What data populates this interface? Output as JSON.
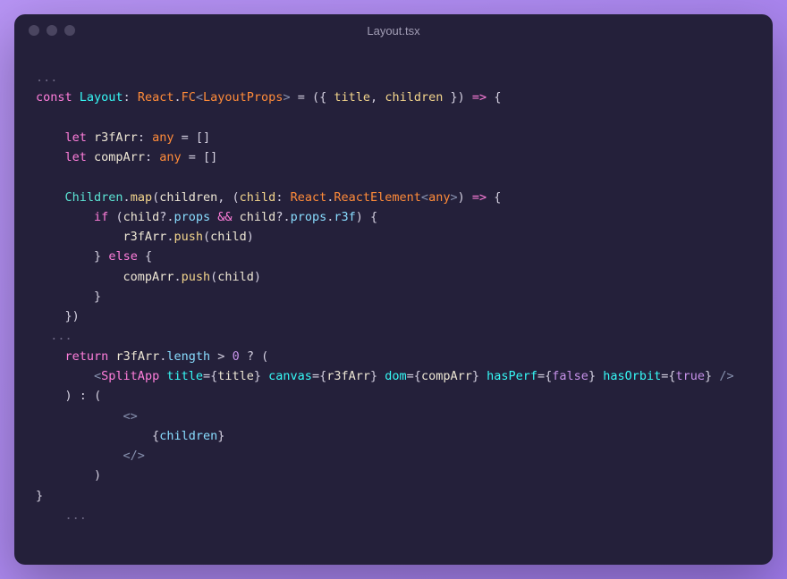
{
  "window": {
    "title": "Layout.tsx"
  },
  "colors": {
    "keyword": "#ff7edb",
    "type": "#ff8b39",
    "const": "#36f9f6",
    "teal": "#5ce5d5",
    "method": "#f3d58c",
    "number": "#c792ea",
    "bool": "#c792ea",
    "angle": "#8892b0",
    "faint": "#6c6783",
    "bg": "#24203a"
  },
  "code": {
    "ellipsis": "...",
    "kw_const": "const",
    "kw_let": "let",
    "kw_if": "if",
    "kw_else": "else",
    "kw_return": "return",
    "cmp_Layout": "Layout",
    "cmp_SplitApp": "SplitApp",
    "type_React": "React",
    "type_FC": "FC",
    "type_LayoutProps": "LayoutProps",
    "type_ReactElement": "ReactElement",
    "type_any": "any",
    "var_title": "title",
    "var_children": "children",
    "var_child": "child",
    "var_r3fArr": "r3fArr",
    "var_compArr": "compArr",
    "var_Children": "Children",
    "method_map": "map",
    "method_push": "push",
    "prop_props": "props",
    "prop_r3f": "r3f",
    "prop_length": "length",
    "attr_title": "title",
    "attr_canvas": "canvas",
    "attr_dom": "dom",
    "attr_hasPerf": "hasPerf",
    "attr_hasOrbit": "hasOrbit",
    "op_and": "&&",
    "op_gt": ">",
    "op_optchain": "?.",
    "op_assign": "=",
    "op_arrow": "=>",
    "num_0": "0",
    "bool_false": "false",
    "bool_true": "true",
    "empty_arr": "[]"
  }
}
